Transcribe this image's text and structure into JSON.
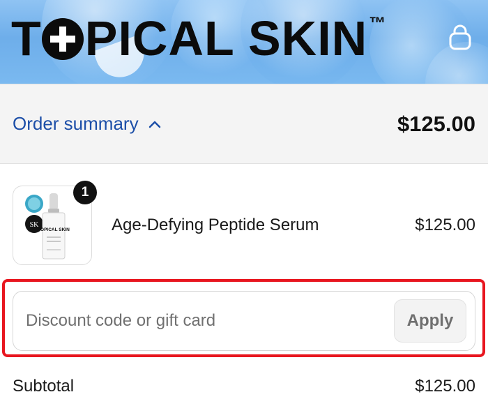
{
  "header": {
    "logo_text_start": "T",
    "logo_text_end": "PICAL SKIN",
    "logo_trademark": "™",
    "cart_icon": "shopping-bag-icon"
  },
  "summary": {
    "toggle_label": "Order summary",
    "toggle_icon": "chevron-up-icon",
    "total": "$125.00"
  },
  "line_items": [
    {
      "name": "Age-Defying Peptide Serum",
      "price": "$125.00",
      "quantity": "1",
      "image_brand_text": "TOPICAL SKIN"
    }
  ],
  "discount": {
    "placeholder": "Discount code or gift card",
    "value": "",
    "apply_label": "Apply"
  },
  "totals": {
    "subtotal_label": "Subtotal",
    "subtotal_value": "$125.00"
  },
  "colors": {
    "link_blue": "#1d4fa8",
    "highlight_red": "#e8161f",
    "header_blue": "#7ab9f0"
  }
}
